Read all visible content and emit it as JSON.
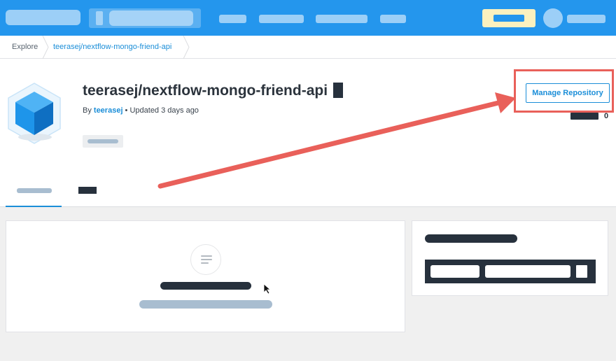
{
  "breadcrumb": {
    "explore": "Explore",
    "repo": "teerasej/nextflow-mongo-friend-api"
  },
  "repo": {
    "title": "teerasej/nextflow-mongo-friend-api",
    "by_prefix": "By ",
    "owner": "teerasej",
    "updated": " • Updated 3 days ago",
    "star_count": "0"
  },
  "actions": {
    "manage_label": "Manage Repository"
  },
  "colors": {
    "brand": "#2496ed",
    "link": "#1b8ed8",
    "annotation": "#e9605a"
  }
}
